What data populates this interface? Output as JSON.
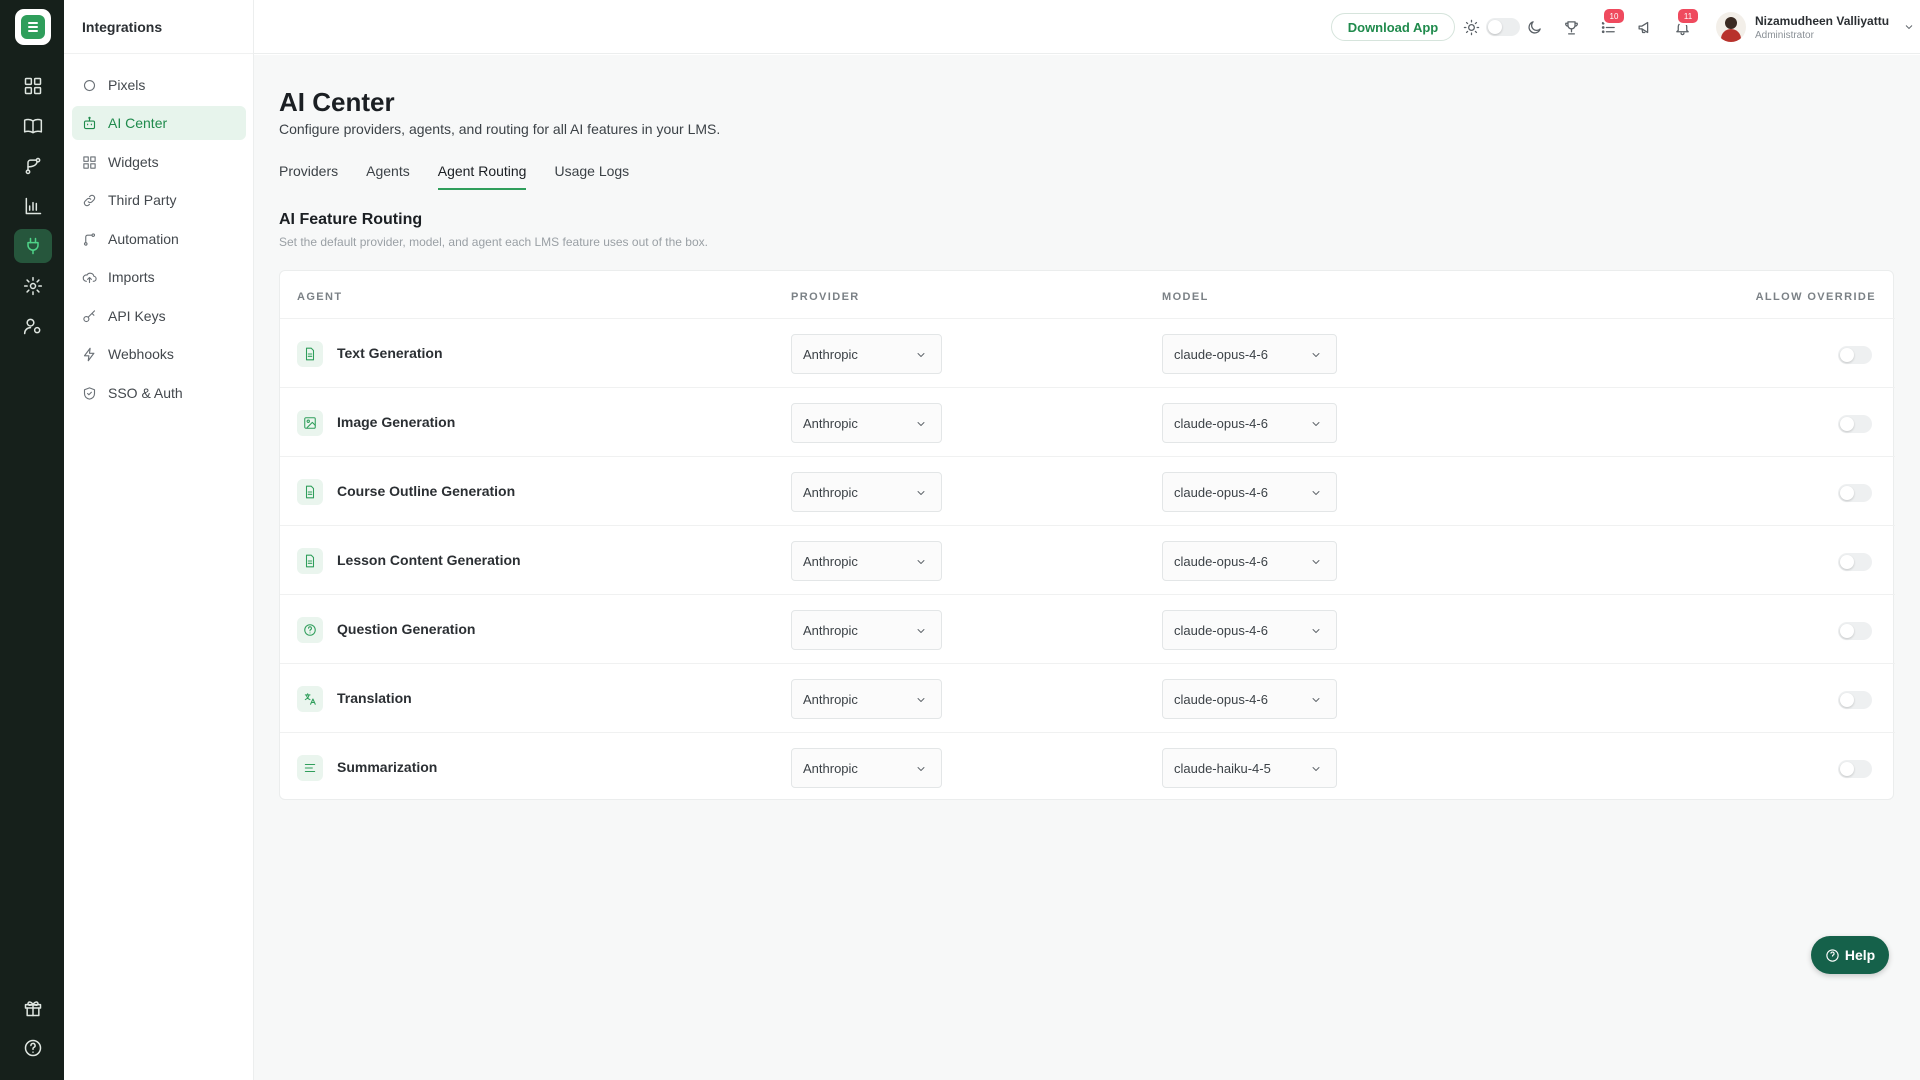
{
  "sidebar": {
    "header": "Integrations",
    "items": [
      {
        "label": "Pixels",
        "icon": "circle-icon"
      },
      {
        "label": "AI Center",
        "icon": "robot-icon"
      },
      {
        "label": "Widgets",
        "icon": "grid-icon"
      },
      {
        "label": "Third Party",
        "icon": "link-icon"
      },
      {
        "label": "Automation",
        "icon": "branch-icon"
      },
      {
        "label": "Imports",
        "icon": "cloud-upload-icon"
      },
      {
        "label": "API Keys",
        "icon": "key-icon"
      },
      {
        "label": "Webhooks",
        "icon": "webhook-icon"
      },
      {
        "label": "SSO & Auth",
        "icon": "shield-check-icon"
      }
    ],
    "active": "AI Center"
  },
  "topbar": {
    "download_label": "Download App",
    "list_badge": "10",
    "bell_badge": "11",
    "user_name": "Nizamudheen Valliyattu",
    "user_role": "Administrator"
  },
  "page": {
    "title": "AI Center",
    "subtitle": "Configure providers, agents, and routing for all AI features in your LMS.",
    "tabs": [
      "Providers",
      "Agents",
      "Agent Routing",
      "Usage Logs"
    ],
    "active_tab": "Agent Routing"
  },
  "routing": {
    "title": "AI Feature Routing",
    "subtitle": "Set the default provider, model, and agent each LMS feature uses out of the box.",
    "columns": [
      "AGENT",
      "PROVIDER",
      "MODEL",
      "ALLOW OVERRIDE"
    ],
    "rows": [
      {
        "agent": "Text Generation",
        "icon": "document-icon",
        "provider": "Anthropic",
        "model": "claude-opus-4-6",
        "override": false
      },
      {
        "agent": "Image Generation",
        "icon": "image-icon",
        "provider": "Anthropic",
        "model": "claude-opus-4-6",
        "override": false
      },
      {
        "agent": "Course Outline Generation",
        "icon": "document-icon",
        "provider": "Anthropic",
        "model": "claude-opus-4-6",
        "override": false
      },
      {
        "agent": "Lesson Content Generation",
        "icon": "document-icon",
        "provider": "Anthropic",
        "model": "claude-opus-4-6",
        "override": false
      },
      {
        "agent": "Question Generation",
        "icon": "question-circle-icon",
        "provider": "Anthropic",
        "model": "claude-opus-4-6",
        "override": false
      },
      {
        "agent": "Translation",
        "icon": "translate-icon",
        "provider": "Anthropic",
        "model": "claude-opus-4-6",
        "override": false
      },
      {
        "agent": "Summarization",
        "icon": "align-left-icon",
        "provider": "Anthropic",
        "model": "claude-haiku-4-5",
        "override": false
      }
    ]
  },
  "help_label": "Help",
  "colors": {
    "rail_bg": "#16201b",
    "accent": "#2f9e5b",
    "help_bg": "#15614a",
    "badge": "#ef4a5e"
  }
}
